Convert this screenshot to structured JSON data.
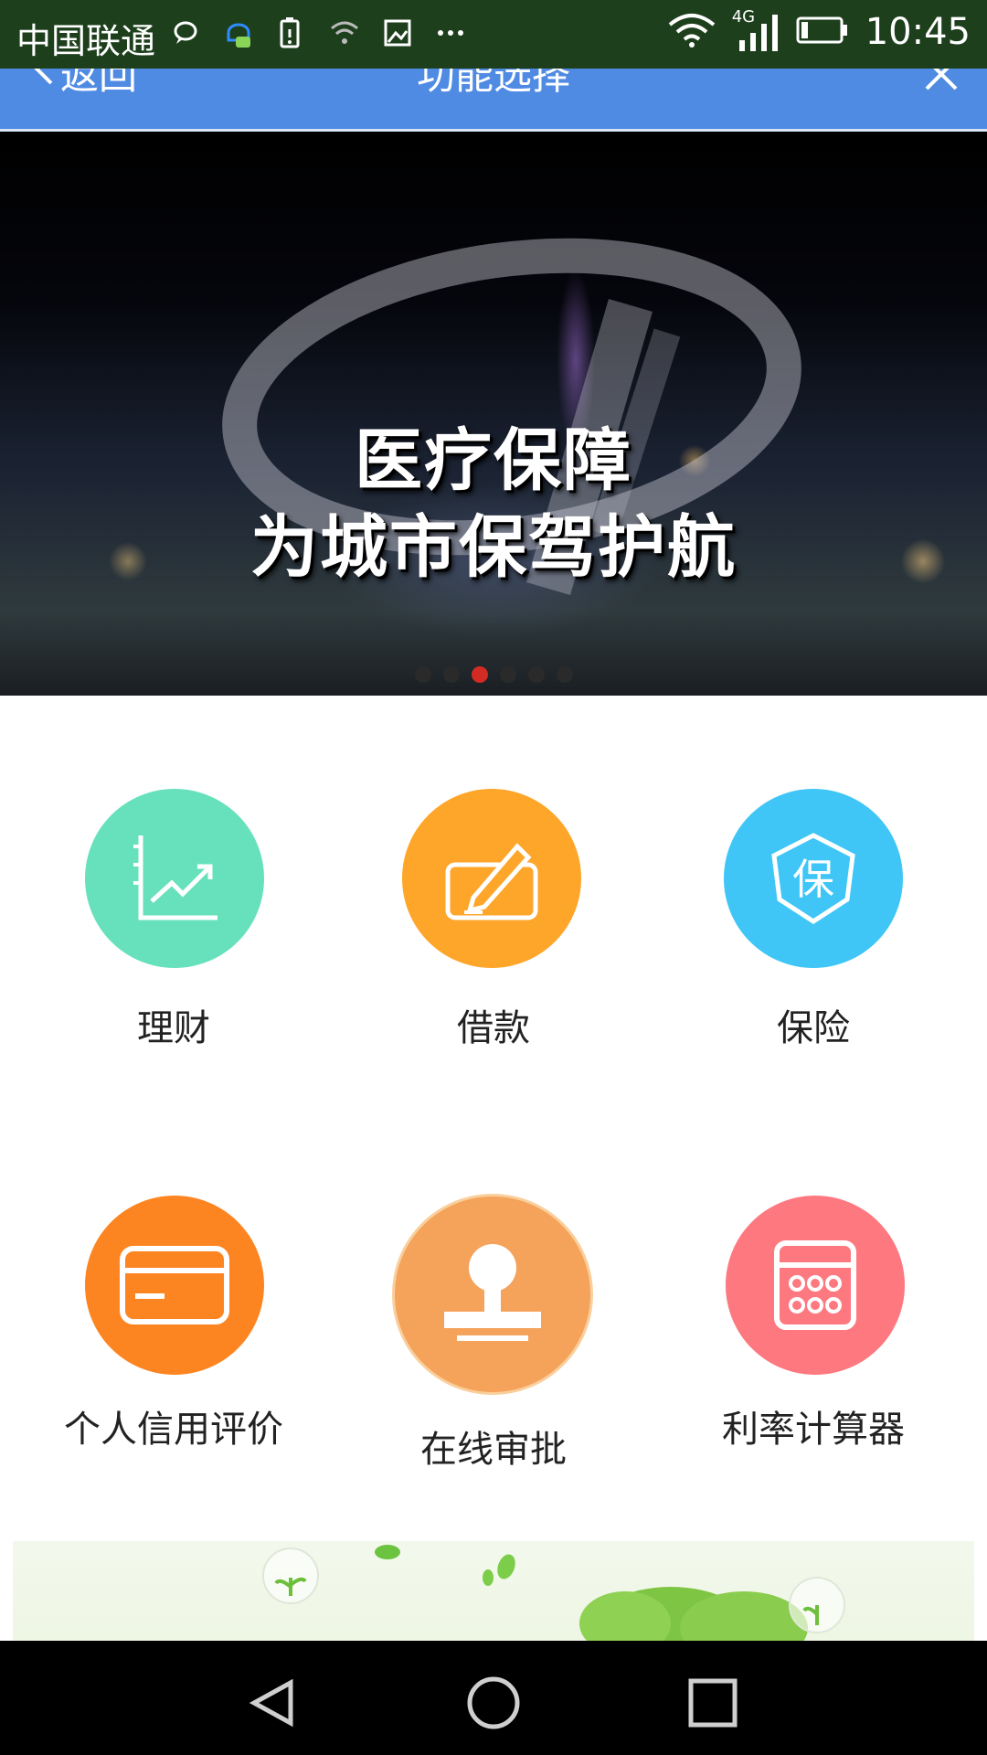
{
  "status_bar": {
    "carrier": "中国联通",
    "network": "4G",
    "time": "10:45"
  },
  "nav": {
    "back_label": "返回",
    "title": "功能选择"
  },
  "banner": {
    "line1": "医疗保障",
    "line2": "为城市保驾护航",
    "active_dot": 3,
    "dot_count": 6
  },
  "functions": [
    {
      "label": "理财",
      "color": "#67e1bb",
      "icon": "chart-icon"
    },
    {
      "label": "借款",
      "color": "#fea62a",
      "icon": "pen-sign-icon"
    },
    {
      "label": "保险",
      "color": "#3fc6f7",
      "icon": "shield-icon"
    },
    {
      "label": "个人信用评价",
      "color": "#fd8521",
      "icon": "credit-card-icon"
    },
    {
      "label": "在线审批",
      "color": "#f5a25b",
      "icon": "stamp-icon"
    },
    {
      "label": "利率计算器",
      "color": "#fe7880",
      "icon": "calculator-icon"
    }
  ],
  "colors": {
    "nav_bg": "#4f8ae3",
    "status_bg": "#1d3f1c"
  }
}
